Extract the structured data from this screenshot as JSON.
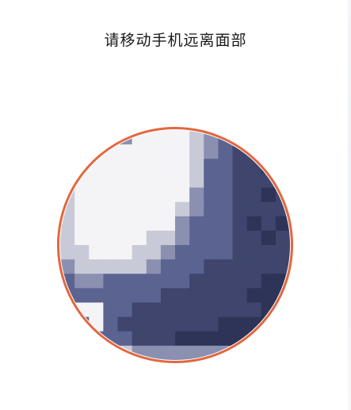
{
  "screen": {
    "instruction": "请移动手机远离面部"
  },
  "camera": {
    "state": "face-preview-pixelated",
    "ring_color": "#e2673f",
    "palette": {
      "white": "#f4f4f7",
      "light": "#c9cad8",
      "mid": "#8b8fb0",
      "blue": "#5b6390",
      "dark": "#3f456d",
      "deep": "#2e3358"
    }
  }
}
